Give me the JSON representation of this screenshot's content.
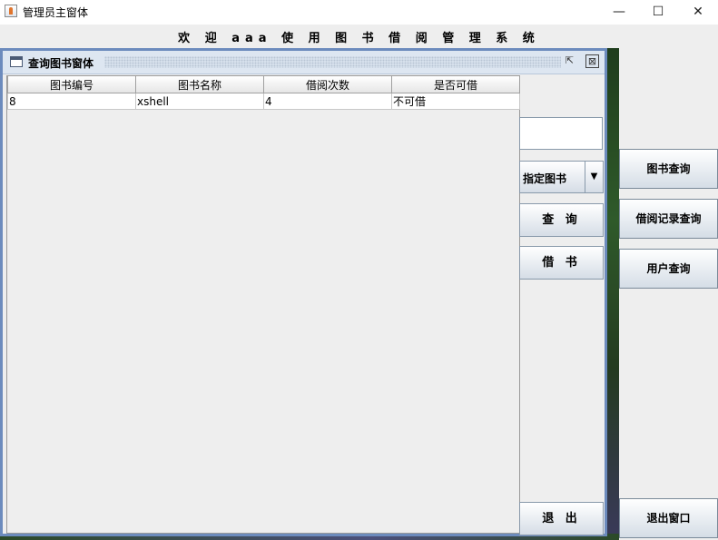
{
  "window": {
    "title": "管理员主窗体",
    "minimize": "—",
    "maximize": "☐",
    "close": "✕"
  },
  "menubar": {
    "welcome": "欢 迎 aaa 使 用 图 书 借 阅 管 理 系 统"
  },
  "internal_frame": {
    "title": "查询图书窗体",
    "restore": "⇱",
    "close": "⊠"
  },
  "table": {
    "columns": [
      "图书编号",
      "图书名称",
      "借阅次数",
      "是否可借"
    ],
    "rows": [
      [
        "8",
        "xshell",
        "4",
        "不可借"
      ]
    ]
  },
  "search": {
    "value": "",
    "placeholder": ""
  },
  "filter_select": {
    "selected": "指定图书"
  },
  "frame_buttons": {
    "query": "查 询",
    "borrow": "借 书",
    "exit": "退 出"
  },
  "right_nav": {
    "book_query": "图书查询",
    "borrow_record_query": "借阅记录查询",
    "user_query": "用户查询",
    "exit_window": "退出窗口"
  },
  "icons": {
    "app": "java-icon",
    "frame": "window-icon",
    "dropdown": "triangle-down-icon"
  }
}
